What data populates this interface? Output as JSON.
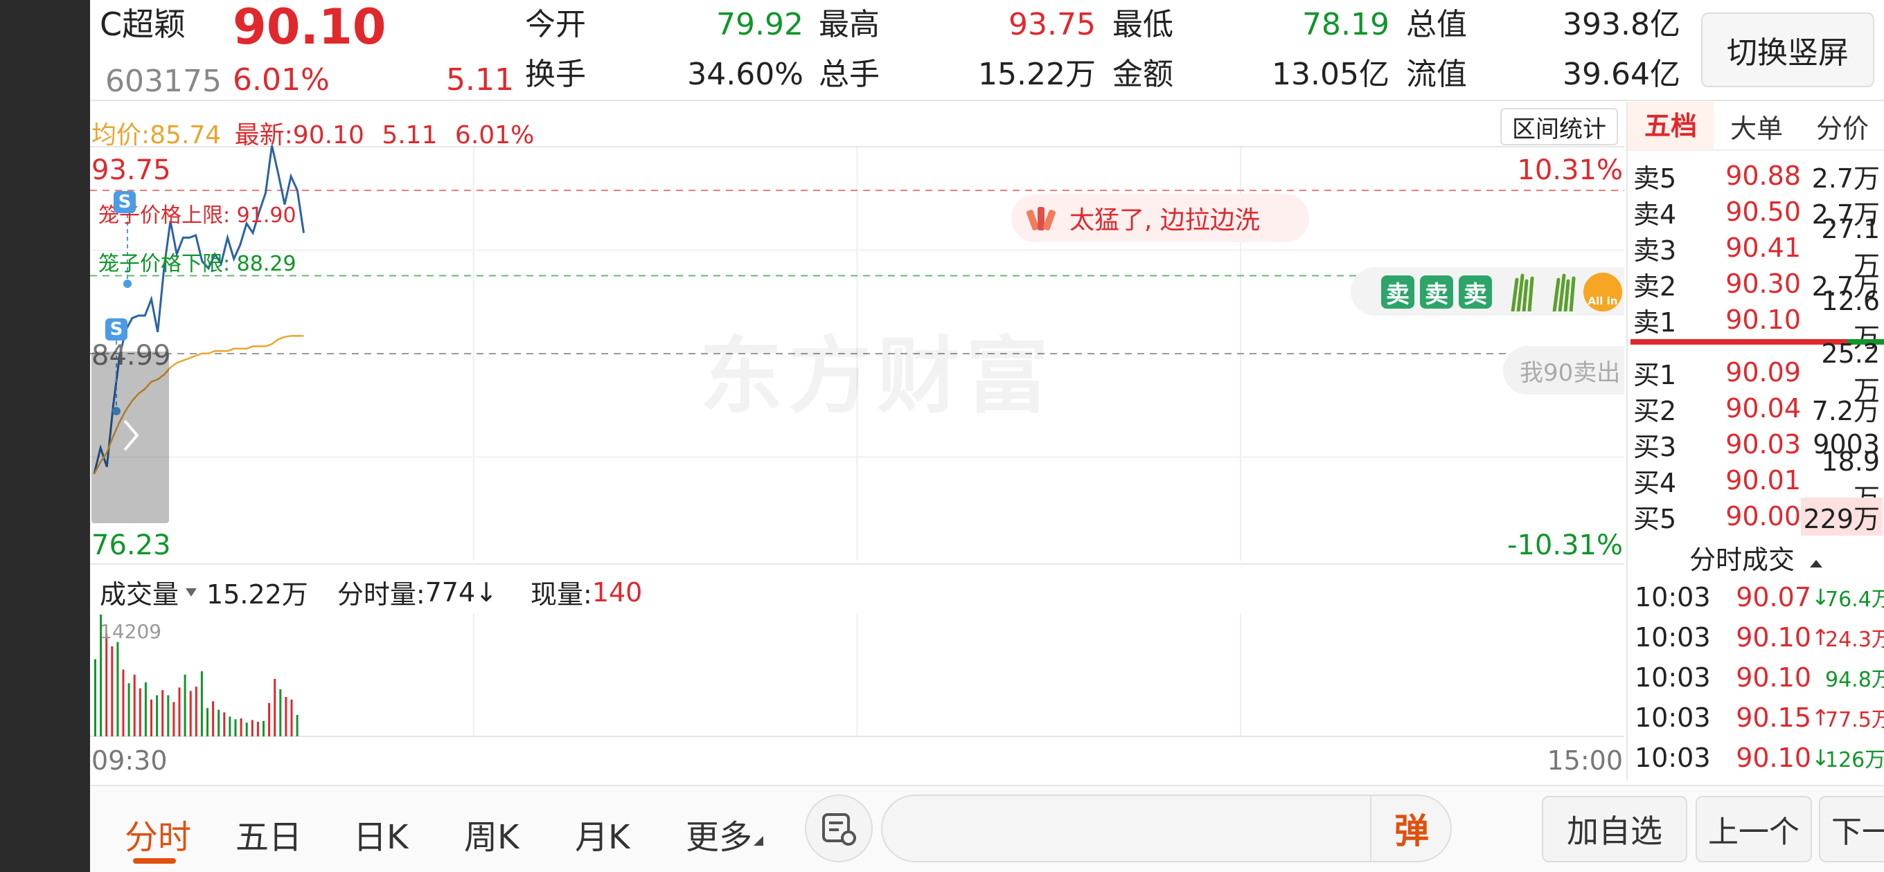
{
  "header": {
    "name": "C超颖",
    "code": "603175",
    "price": "90.10",
    "change_pct": "6.01%",
    "change": "5.11",
    "stats": [
      {
        "label": "今开",
        "value": "79.92",
        "color": "#10962a"
      },
      {
        "label": "最高",
        "value": "93.75",
        "color": "#e0282d"
      },
      {
        "label": "最低",
        "value": "78.19",
        "color": "#10962a"
      },
      {
        "label": "总值",
        "value": "393.8亿",
        "color": "#222222"
      },
      {
        "label": "换手",
        "value": "34.60%",
        "color": "#222222"
      },
      {
        "label": "总手",
        "value": "15.22万",
        "color": "#222222"
      },
      {
        "label": "金额",
        "value": "13.05亿",
        "color": "#222222"
      },
      {
        "label": "流值",
        "value": "39.64亿",
        "color": "#222222"
      }
    ],
    "orientation_button": "切换竖屏"
  },
  "chart": {
    "avg_label": "均价:",
    "avg_value": "85.74",
    "latest_label": "最新:",
    "latest_value": "90.10",
    "latest_change": "5.11",
    "latest_pct": "6.01%",
    "range_button": "区间统计",
    "y_top": "93.75",
    "y_mid": "84.99",
    "y_bottom": "76.23",
    "pct_top": "10.31%",
    "pct_bottom": "-10.31%",
    "cage_upper": "笼子价格上限: 91.90",
    "cage_lower": "笼子价格下限: 88.29",
    "bubble_text": "太猛了, 边拉边洗",
    "sell_label": "卖",
    "allin_label": "All in",
    "me90_text": "我90卖出",
    "watermark": "东方财富",
    "signal_label": "S",
    "x_start": "09:30",
    "x_end": "15:00",
    "colors": {
      "price": "#2a63a6",
      "avg": "#e9a52f",
      "up": "#e0282d",
      "down": "#10962a"
    }
  },
  "chart_data": {
    "type": "line",
    "ylim": [
      76.23,
      93.75
    ],
    "prev_close": 84.99,
    "x": [
      "09:30",
      "09:31",
      "09:32",
      "09:33",
      "09:34",
      "09:35",
      "09:36",
      "09:37",
      "09:38",
      "09:39",
      "09:40",
      "09:41",
      "09:42",
      "09:43",
      "09:44",
      "09:45",
      "09:46",
      "09:47",
      "09:48",
      "09:49",
      "09:50",
      "09:51",
      "09:52",
      "09:53",
      "09:54",
      "09:55",
      "09:56",
      "09:57",
      "09:58",
      "09:59",
      "10:00",
      "10:01",
      "10:02",
      "10:03"
    ],
    "series": [
      {
        "values": [
          79.9,
          81.0,
          80.2,
          82.8,
          84.9,
          86.0,
          86.5,
          86.6,
          86.6,
          87.3,
          85.9,
          88.6,
          90.6,
          89.2,
          89.9,
          89.9,
          90.0,
          88.9,
          88.6,
          89.2,
          88.8,
          89.9,
          89.0,
          89.6,
          90.5,
          90.1,
          91.0,
          91.8,
          93.8,
          92.6,
          91.3,
          92.5,
          91.9,
          90.1
        ]
      },
      {
        "values": [
          79.9,
          80.4,
          80.8,
          81.5,
          82.1,
          82.6,
          83.0,
          83.3,
          83.5,
          83.8,
          83.9,
          84.1,
          84.4,
          84.6,
          84.7,
          84.8,
          84.9,
          85.0,
          85.0,
          85.1,
          85.1,
          85.1,
          85.2,
          85.2,
          85.2,
          85.3,
          85.3,
          85.3,
          85.4,
          85.6,
          85.7,
          85.74,
          85.74,
          85.74
        ]
      }
    ]
  },
  "volume": {
    "label": "成交量",
    "total": "15.22万",
    "period_label": "分时量:",
    "period_value": "774",
    "period_arrow": "↓",
    "now_label": "现量:",
    "now_value": "140",
    "max_label": "14209",
    "bars": [
      9000,
      14209,
      12000,
      10500,
      11000,
      7800,
      6200,
      7200,
      5600,
      6300,
      4300,
      4800,
      5400,
      4800,
      4000,
      5700,
      7200,
      5300,
      5800,
      7600,
      3300,
      4100,
      3100,
      2800,
      2300,
      2000,
      2100,
      1600,
      1900,
      1700,
      1800,
      3900,
      6700,
      5500,
      4600,
      4300,
      2500
    ],
    "bar_colors": [
      "d",
      "d",
      "u",
      "u",
      "d",
      "u",
      "d",
      "u",
      "u",
      "d",
      "u",
      "d",
      "u",
      "d",
      "u",
      "u",
      "d",
      "u",
      "u",
      "d",
      "d",
      "u",
      "d",
      "u",
      "d",
      "d",
      "u",
      "d",
      "u",
      "u",
      "d",
      "u",
      "u",
      "d",
      "u",
      "u",
      "d"
    ]
  },
  "book": {
    "tabs": [
      "五档",
      "大单",
      "分价"
    ],
    "asks": [
      {
        "label": "卖5",
        "price": "90.88",
        "vol": "2.7万"
      },
      {
        "label": "卖4",
        "price": "90.50",
        "vol": "2.7万"
      },
      {
        "label": "卖3",
        "price": "90.41",
        "vol": "27.1万"
      },
      {
        "label": "卖2",
        "price": "90.30",
        "vol": "2.7万"
      },
      {
        "label": "卖1",
        "price": "90.10",
        "vol": "12.6万"
      }
    ],
    "bids": [
      {
        "label": "买1",
        "price": "90.09",
        "vol": "25.2万"
      },
      {
        "label": "买2",
        "price": "90.04",
        "vol": "7.2万"
      },
      {
        "label": "买3",
        "price": "90.03",
        "vol": "9003"
      },
      {
        "label": "买4",
        "price": "90.01",
        "vol": "18.9万"
      },
      {
        "label": "买5",
        "price": "90.00",
        "vol": "229万"
      }
    ],
    "trades_header": "分时成交",
    "trades": [
      {
        "time": "10:03",
        "price": "90.07",
        "arrow": "↓",
        "vol": "76.4万",
        "dir": "down"
      },
      {
        "time": "10:03",
        "price": "90.10",
        "arrow": "↑",
        "vol": "24.3万",
        "dir": "up"
      },
      {
        "time": "10:03",
        "price": "90.10",
        "arrow": "",
        "vol": "94.8万",
        "dir": "flat"
      },
      {
        "time": "10:03",
        "price": "90.15",
        "arrow": "↑",
        "vol": "77.5万",
        "dir": "up"
      },
      {
        "time": "10:03",
        "price": "90.10",
        "arrow": "↓",
        "vol": "126万",
        "dir": "down"
      }
    ]
  },
  "bottom": {
    "period_tabs": [
      "分时",
      "五日",
      "日K",
      "周K",
      "月K",
      "更多"
    ],
    "danmu_button": "弹",
    "add_watch": "加自选",
    "prev": "上一个",
    "next": "下一个"
  }
}
